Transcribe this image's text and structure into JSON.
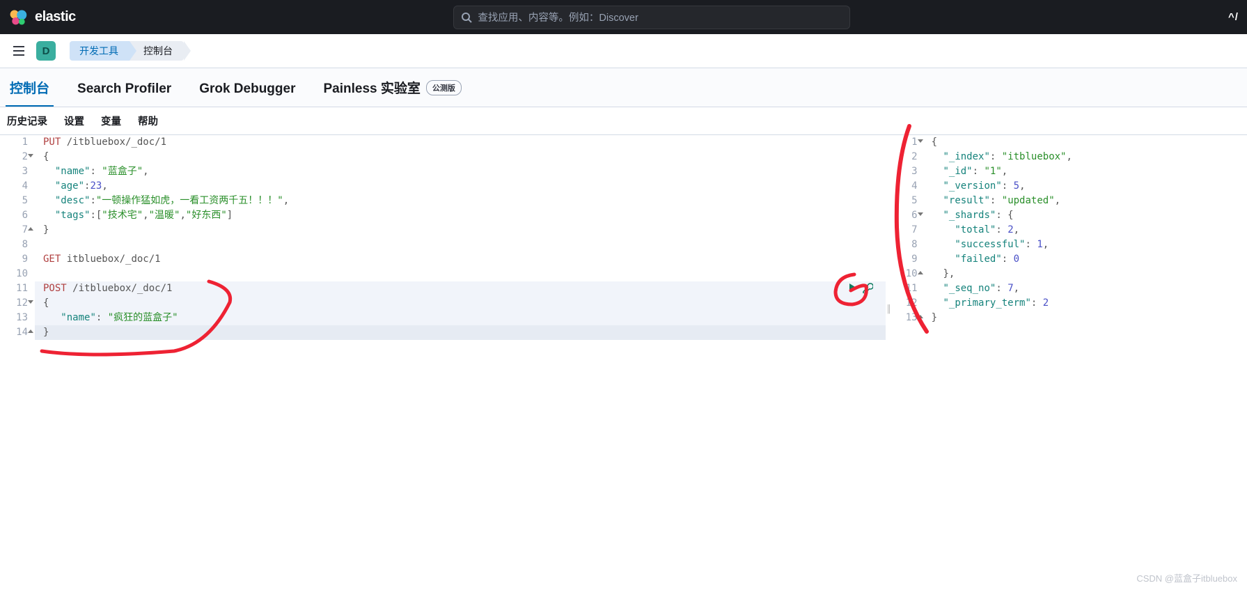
{
  "header": {
    "brand": "elastic",
    "search_placeholder": "查找应用、内容等。例如：Discover",
    "a11y_label": "^/"
  },
  "crumb_bar": {
    "space_letter": "D",
    "crumbs": [
      "开发工具",
      "控制台"
    ]
  },
  "main_tabs": {
    "items": [
      {
        "label": "控制台",
        "selected": true
      },
      {
        "label": "Search Profiler",
        "selected": false
      },
      {
        "label": "Grok Debugger",
        "selected": false
      },
      {
        "label": "Painless 实验室",
        "selected": false,
        "badge": "公测版"
      }
    ]
  },
  "sub_tabs": {
    "items": [
      "历史记录",
      "设置",
      "变量",
      "帮助"
    ]
  },
  "editor": {
    "lines": [
      {
        "n": 1,
        "tokens": [
          [
            "kw",
            "PUT"
          ],
          [
            "space",
            " "
          ],
          [
            "path",
            "/itbluebox/_doc/1"
          ]
        ]
      },
      {
        "n": 2,
        "fold": "open",
        "tokens": [
          [
            "punct",
            "{"
          ]
        ]
      },
      {
        "n": 3,
        "tokens": [
          [
            "space",
            "  "
          ],
          [
            "key",
            "\"name\""
          ],
          [
            "punct",
            ": "
          ],
          [
            "str",
            "\"蓝盒子\""
          ],
          [
            "punct",
            ","
          ]
        ]
      },
      {
        "n": 4,
        "tokens": [
          [
            "space",
            "  "
          ],
          [
            "key",
            "\"age\""
          ],
          [
            "punct",
            ":"
          ],
          [
            "num",
            "23"
          ],
          [
            "punct",
            ","
          ]
        ]
      },
      {
        "n": 5,
        "tokens": [
          [
            "space",
            "  "
          ],
          [
            "key",
            "\"desc\""
          ],
          [
            "punct",
            ":"
          ],
          [
            "str",
            "\"一顿操作猛如虎，一看工资两千五！！！\""
          ],
          [
            "punct",
            ","
          ]
        ]
      },
      {
        "n": 6,
        "tokens": [
          [
            "space",
            "  "
          ],
          [
            "key",
            "\"tags\""
          ],
          [
            "punct",
            ":["
          ],
          [
            "str",
            "\"技术宅\""
          ],
          [
            "punct",
            ","
          ],
          [
            "str",
            "\"温暖\""
          ],
          [
            "punct",
            ","
          ],
          [
            "str",
            "\"好东西\""
          ],
          [
            "punct",
            "]"
          ]
        ]
      },
      {
        "n": 7,
        "fold": "close",
        "tokens": [
          [
            "punct",
            "}"
          ]
        ]
      },
      {
        "n": 8,
        "tokens": []
      },
      {
        "n": 9,
        "tokens": [
          [
            "kw",
            "GET"
          ],
          [
            "space",
            " "
          ],
          [
            "path",
            "itbluebox/_doc/1"
          ]
        ]
      },
      {
        "n": 10,
        "tokens": []
      },
      {
        "n": 11,
        "tokens": [
          [
            "kw",
            "POST"
          ],
          [
            "space",
            " "
          ],
          [
            "path",
            "/itbluebox/_doc/1"
          ]
        ]
      },
      {
        "n": 12,
        "fold": "open",
        "tokens": [
          [
            "punct",
            "{"
          ]
        ]
      },
      {
        "n": 13,
        "tokens": [
          [
            "space",
            "   "
          ],
          [
            "key",
            "\"name\""
          ],
          [
            "punct",
            ": "
          ],
          [
            "str",
            "\"疯狂的蓝盒子\""
          ]
        ]
      },
      {
        "n": 14,
        "fold": "close",
        "tokens": [
          [
            "punct",
            "}"
          ]
        ]
      }
    ]
  },
  "response": {
    "lines": [
      {
        "n": 1,
        "fold": "open",
        "tokens": [
          [
            "punct",
            "{"
          ]
        ]
      },
      {
        "n": 2,
        "tokens": [
          [
            "space",
            "  "
          ],
          [
            "key",
            "\"_index\""
          ],
          [
            "punct",
            ": "
          ],
          [
            "str",
            "\"itbluebox\""
          ],
          [
            "punct",
            ","
          ]
        ]
      },
      {
        "n": 3,
        "tokens": [
          [
            "space",
            "  "
          ],
          [
            "key",
            "\"_id\""
          ],
          [
            "punct",
            ": "
          ],
          [
            "str",
            "\"1\""
          ],
          [
            "punct",
            ","
          ]
        ]
      },
      {
        "n": 4,
        "tokens": [
          [
            "space",
            "  "
          ],
          [
            "key",
            "\"_version\""
          ],
          [
            "punct",
            ": "
          ],
          [
            "num",
            "5"
          ],
          [
            "punct",
            ","
          ]
        ]
      },
      {
        "n": 5,
        "tokens": [
          [
            "space",
            "  "
          ],
          [
            "key",
            "\"result\""
          ],
          [
            "punct",
            ": "
          ],
          [
            "str",
            "\"updated\""
          ],
          [
            "punct",
            ","
          ]
        ]
      },
      {
        "n": 6,
        "fold": "open",
        "tokens": [
          [
            "space",
            "  "
          ],
          [
            "key",
            "\"_shards\""
          ],
          [
            "punct",
            ": {"
          ]
        ]
      },
      {
        "n": 7,
        "tokens": [
          [
            "space",
            "    "
          ],
          [
            "key",
            "\"total\""
          ],
          [
            "punct",
            ": "
          ],
          [
            "num",
            "2"
          ],
          [
            "punct",
            ","
          ]
        ]
      },
      {
        "n": 8,
        "tokens": [
          [
            "space",
            "    "
          ],
          [
            "key",
            "\"successful\""
          ],
          [
            "punct",
            ": "
          ],
          [
            "num",
            "1"
          ],
          [
            "punct",
            ","
          ]
        ]
      },
      {
        "n": 9,
        "tokens": [
          [
            "space",
            "    "
          ],
          [
            "key",
            "\"failed\""
          ],
          [
            "punct",
            ": "
          ],
          [
            "num",
            "0"
          ]
        ]
      },
      {
        "n": 10,
        "fold": "close",
        "tokens": [
          [
            "space",
            "  "
          ],
          [
            "punct",
            "},"
          ]
        ]
      },
      {
        "n": 11,
        "tokens": [
          [
            "space",
            "  "
          ],
          [
            "key",
            "\"_seq_no\""
          ],
          [
            "punct",
            ": "
          ],
          [
            "num",
            "7"
          ],
          [
            "punct",
            ","
          ]
        ]
      },
      {
        "n": 12,
        "tokens": [
          [
            "space",
            "  "
          ],
          [
            "key",
            "\"_primary_term\""
          ],
          [
            "punct",
            ": "
          ],
          [
            "num",
            "2"
          ]
        ]
      },
      {
        "n": 13,
        "fold": "close",
        "tokens": [
          [
            "punct",
            "}"
          ]
        ]
      }
    ]
  },
  "watermark": "CSDN @蓝盒子itbluebox"
}
